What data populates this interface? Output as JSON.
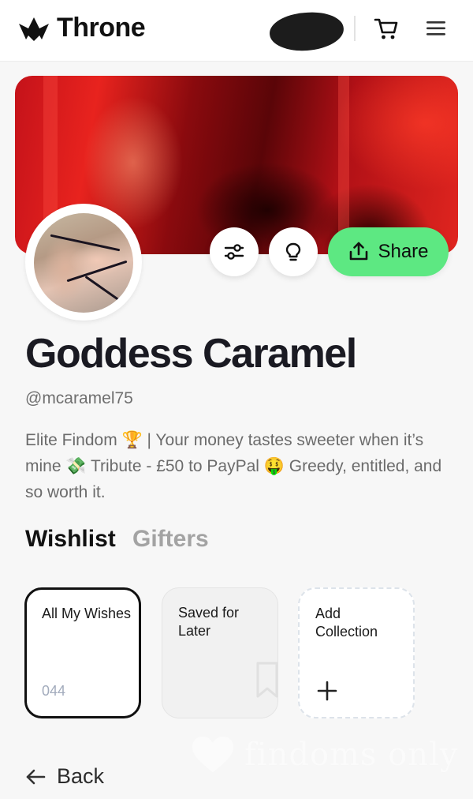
{
  "app": {
    "name": "Throne"
  },
  "profile": {
    "display_name": "Goddess Caramel",
    "handle": "@mcaramel75",
    "bio": "Elite Findom 🏆 | Your money tastes sweeter when it’s mine 💸 Tribute - £50 to PayPal 🤑 Greedy, entitled, and so worth it."
  },
  "actions": {
    "share_label": "Share"
  },
  "tabs": [
    {
      "label": "Wishlist",
      "active": true
    },
    {
      "label": "Gifters",
      "active": false
    }
  ],
  "collections": [
    {
      "title": "All My Wishes",
      "count": "044",
      "selected": true
    },
    {
      "title": "Saved for Later"
    },
    {
      "title": "Add Collection",
      "icon": "plus-icon"
    }
  ],
  "nav": {
    "back_label": "Back"
  },
  "watermark": {
    "text": "findoms only"
  },
  "colors": {
    "share_green": "#5de882",
    "banner_red": "#e8231e",
    "count_blue_gray": "#a2abbc"
  }
}
